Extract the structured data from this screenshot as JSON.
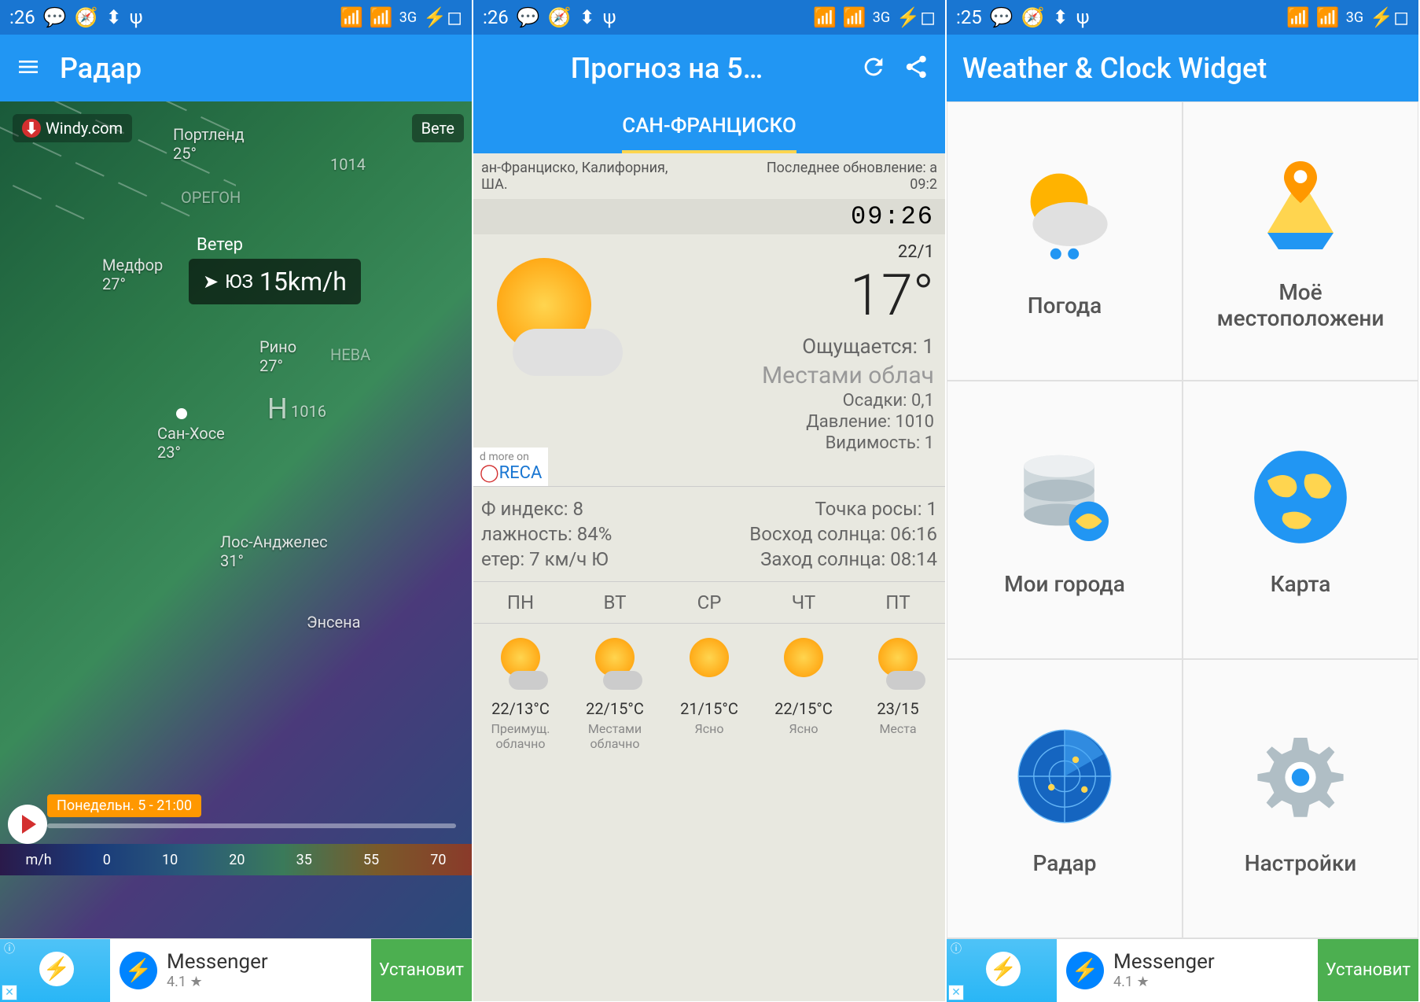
{
  "status": {
    "time1": ":26",
    "time2": ":26",
    "time3": ":25",
    "signal": "3G"
  },
  "screen1": {
    "title": "Радар",
    "windy": "Windy.com",
    "labels": {
      "portland": "Портленд",
      "portland_t": "25°",
      "oregon": "ОРЕГОН",
      "medford": "Медфор",
      "medford_t": "27°",
      "reno": "Рино",
      "reno_t": "27°",
      "nevada": "НЕВА",
      "sanjose": "Сан-Хосе",
      "sanjose_t": "23°",
      "la": "Лос-Анджелес",
      "la_t": "31°",
      "ensenada": "Энсена",
      "wind": "Ветер",
      "wind_btn": "Вете",
      "pressure": "1014",
      "pressure2": "1016",
      "h": "H"
    },
    "wind_dir": "ЮЗ",
    "wind_speed": "15km/h",
    "timeline": "Понедельн. 5 - 21:00",
    "scale": {
      "unit": "m/h",
      "v0": "0",
      "v1": "10",
      "v2": "20",
      "v3": "35",
      "v4": "55",
      "v5": "70"
    }
  },
  "screen2": {
    "title": "Прогноз на 5…",
    "tab": "САН-ФРАНЦИСКО",
    "location": "ан-Франциско, Калифорния,\nША.",
    "updated": "Последнее обновление: а\n09:2",
    "time": "09:26",
    "date": "22/1",
    "temp": "17°",
    "feels": "Ощущается: 1",
    "condition": "Местами облач",
    "precip": "Осадки: 0,1",
    "pressure": "Давление: 1010",
    "visibility": "Видимость: 1",
    "read_more": "d more on",
    "foreca": "RECA",
    "uv": "Ф индекс: 8",
    "humidity": "лажность: 84%",
    "wind": "етер: 7 км/ч Ю",
    "dewpoint": "Точка росы: 1",
    "sunrise": "Восход солнца: 06:16",
    "sunset": "Заход солнца: 08:14",
    "days": [
      "ПН",
      "ВТ",
      "СР",
      "ЧТ",
      "ПТ"
    ],
    "forecast": [
      {
        "temp": "22/13°C",
        "cond": "Преимущ. облачно"
      },
      {
        "temp": "22/15°C",
        "cond": "Местами облачно"
      },
      {
        "temp": "21/15°C",
        "cond": "Ясно"
      },
      {
        "temp": "22/15°C",
        "cond": "Ясно"
      },
      {
        "temp": "23/15",
        "cond": "Места"
      }
    ]
  },
  "screen3": {
    "title": "Weather & Clock Widget",
    "items": [
      {
        "label": "Погода"
      },
      {
        "label": "Моё местоположени"
      },
      {
        "label": "Мои города"
      },
      {
        "label": "Карта"
      },
      {
        "label": "Радар"
      },
      {
        "label": "Настройки"
      }
    ]
  },
  "ad": {
    "title": "Messenger",
    "rating": "4.1 ★",
    "install": "Установит"
  }
}
